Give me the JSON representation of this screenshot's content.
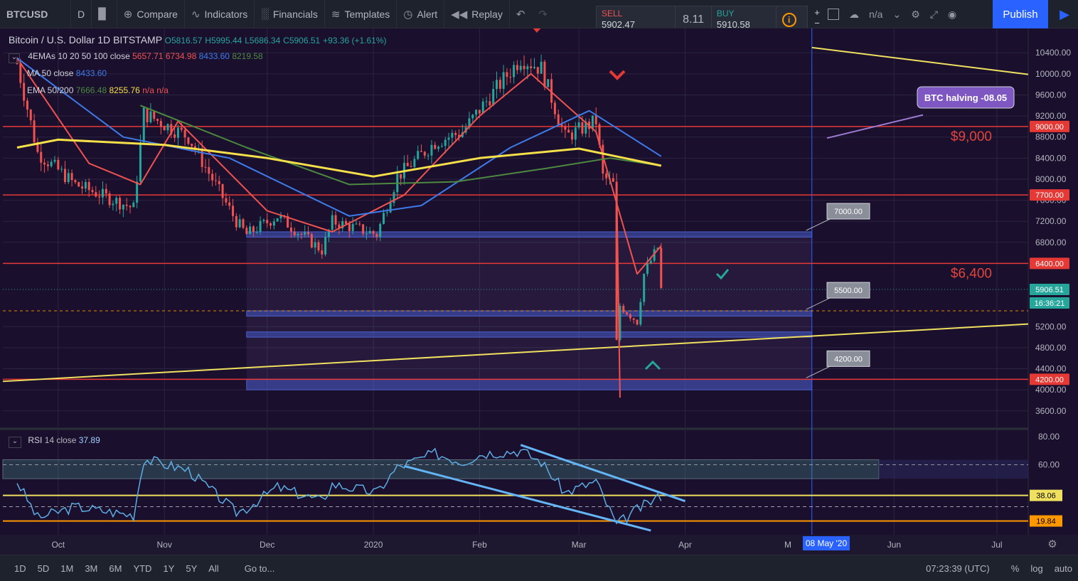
{
  "toolbar": {
    "symbol": "BTCUSD",
    "interval": "D",
    "compare": "Compare",
    "indicators": "Indicators",
    "financials": "Financials",
    "templates": "Templates",
    "alert": "Alert",
    "replay": "Replay",
    "layout_name": "n/a",
    "publish": "Publish"
  },
  "trade_panel": {
    "sell_label": "SELL",
    "sell_price": "5902.47",
    "spread": "8.11",
    "buy_label": "BUY",
    "buy_price": "5910.58",
    "plus": "+",
    "minus": "−"
  },
  "legend": {
    "main": {
      "name": "Bitcoin / U.S. Dollar",
      "interval": "1D",
      "exchange": "BITSTAMP",
      "o": "O5816.57",
      "h": "H5995.44",
      "l": "L5686.34",
      "c": "C5906.51",
      "chg": "+93.36 (+1.61%)"
    },
    "ema4": {
      "name": "4EMAs 10 20 50 100 close",
      "v1": "5657.71",
      "v2": "6734.98",
      "v3": "8433.60",
      "v4": "8219.58"
    },
    "ma50": {
      "name": "MA 50 close",
      "v1": "8433.60"
    },
    "ema50200": {
      "name": "EMA 50/200",
      "v1": "7666.48",
      "v2": "8255.76",
      "v3": "n/a",
      "v4": "n/a"
    },
    "rsi": {
      "name": "RSI",
      "params": "14 close",
      "v1": "37.89"
    }
  },
  "bottom_bar": {
    "ranges": [
      "1D",
      "5D",
      "1M",
      "3M",
      "6M",
      "YTD",
      "1Y",
      "5Y",
      "All"
    ],
    "goto": "Go to...",
    "clock": "07:23:39 (UTC)",
    "pct": "%",
    "log": "log",
    "auto": "auto"
  },
  "colors": {
    "background": "#1b0f2e",
    "up": "#26a69a",
    "down": "#ef5350",
    "ema10": "#ef5350",
    "ma50": "#3d7be8",
    "ema50": "#4c8a3f",
    "ema200": "#f5e04a",
    "trend": "#f0e060",
    "level": "#e53935",
    "zone": "#3a4fb0"
  },
  "chart_data": [
    {
      "type": "candlestick",
      "title": "Bitcoin / U.S. Dollar 1D BITSTAMP",
      "ylim": [
        3300,
        10700
      ],
      "yticks": [
        "10400.00",
        "10000.00",
        "9600.00",
        "9200.00",
        "8800.00",
        "8400.00",
        "8000.00",
        "7600.00",
        "7200.00",
        "6800.00",
        "5200.00",
        "4800.00",
        "4400.00",
        "4000.00",
        "3600.00"
      ],
      "xticks": [
        "Oct",
        "Nov",
        "Dec",
        "2020",
        "Feb",
        "Mar",
        "Apr",
        "Jun",
        "Jul"
      ],
      "x_range": [
        "2019-09-19",
        "2020-07-06"
      ],
      "price_tags": [
        {
          "label": "9000.00",
          "value": 9000,
          "color": "#e53935"
        },
        {
          "label": "7700.00",
          "value": 7700,
          "color": "#e53935"
        },
        {
          "label": "6400.00",
          "value": 6400,
          "color": "#e53935"
        },
        {
          "label": "5906.51",
          "value": 5906.51,
          "color": "#26a69a"
        },
        {
          "label": "16:36:21",
          "value": 5650,
          "color": "#26a69a"
        },
        {
          "label": "4200.00",
          "value": 4200,
          "color": "#e53935"
        }
      ],
      "horizontal_levels": [
        9000,
        7700,
        6400,
        4200
      ],
      "level_labels": [
        {
          "text": "$9,000",
          "value": 9000
        },
        {
          "text": "$6,400",
          "value": 6400
        }
      ],
      "zones": [
        [
          6900,
          7000
        ],
        [
          5400,
          5500
        ],
        [
          5000,
          5100
        ],
        [
          4000,
          4200
        ]
      ],
      "callouts": [
        {
          "text": "7000.00",
          "value": 7000
        },
        {
          "text": "5500.00",
          "value": 5500
        },
        {
          "text": "4200.00",
          "value": 4200
        }
      ],
      "annotation": "BTC halving -08.05",
      "date_tag": "08 May '20",
      "anchors": [
        {
          "date": "2019-09-19",
          "close": 10200
        },
        {
          "date": "2019-09-25",
          "close": 8500
        },
        {
          "date": "2019-10-06",
          "close": 7900
        },
        {
          "date": "2019-10-23",
          "close": 7450
        },
        {
          "date": "2019-10-26",
          "close": 9250
        },
        {
          "date": "2019-11-08",
          "close": 8800
        },
        {
          "date": "2019-11-22",
          "close": 7200
        },
        {
          "date": "2019-11-25",
          "close": 6950
        },
        {
          "date": "2019-12-04",
          "close": 7300
        },
        {
          "date": "2019-12-17",
          "close": 6650
        },
        {
          "date": "2019-12-20",
          "close": 7200
        },
        {
          "date": "2020-01-02",
          "close": 6950
        },
        {
          "date": "2020-01-08",
          "close": 8050
        },
        {
          "date": "2020-01-19",
          "close": 8700
        },
        {
          "date": "2020-01-27",
          "close": 8900
        },
        {
          "date": "2020-02-02",
          "close": 9400
        },
        {
          "date": "2020-02-13",
          "close": 10300
        },
        {
          "date": "2020-02-19",
          "close": 10100
        },
        {
          "date": "2020-02-26",
          "close": 8800
        },
        {
          "date": "2020-03-06",
          "close": 9100
        },
        {
          "date": "2020-03-08",
          "close": 8050
        },
        {
          "date": "2020-03-11",
          "close": 7900
        },
        {
          "date": "2020-03-12",
          "close": 4900
        },
        {
          "date": "2020-03-13",
          "close": 5600
        },
        {
          "date": "2020-03-18",
          "close": 5300
        },
        {
          "date": "2020-03-20",
          "close": 6200
        },
        {
          "date": "2020-03-24",
          "close": 6700
        },
        {
          "date": "2020-03-25",
          "close": 5906.51
        }
      ],
      "series": [
        {
          "name": "EMA 10",
          "points": [
            [
              "2019-09-19",
              10300
            ],
            [
              "2019-10-10",
              8300
            ],
            [
              "2019-10-25",
              7900
            ],
            [
              "2019-11-05",
              9100
            ],
            [
              "2019-12-01",
              7400
            ],
            [
              "2019-12-20",
              7000
            ],
            [
              "2020-01-10",
              7700
            ],
            [
              "2020-02-01",
              9200
            ],
            [
              "2020-02-16",
              10000
            ],
            [
              "2020-03-06",
              8900
            ],
            [
              "2020-03-18",
              6200
            ],
            [
              "2020-03-25",
              6735
            ]
          ]
        },
        {
          "name": "MA 50",
          "points": [
            [
              "2019-09-19",
              10300
            ],
            [
              "2019-10-20",
              8800
            ],
            [
              "2019-11-20",
              8400
            ],
            [
              "2019-12-25",
              7300
            ],
            [
              "2020-01-15",
              7500
            ],
            [
              "2020-02-10",
              8600
            ],
            [
              "2020-03-04",
              9300
            ],
            [
              "2020-03-25",
              8434
            ]
          ]
        },
        {
          "name": "EMA 50",
          "points": [
            [
              "2019-10-25",
              9400
            ],
            [
              "2019-11-25",
              8600
            ],
            [
              "2019-12-25",
              7900
            ],
            [
              "2020-01-25",
              7950
            ],
            [
              "2020-02-20",
              8200
            ],
            [
              "2020-03-10",
              8400
            ],
            [
              "2020-03-25",
              8256
            ]
          ]
        },
        {
          "name": "EMA 200",
          "points": [
            [
              "2019-09-19",
              8600
            ],
            [
              "2019-10-01",
              8750
            ],
            [
              "2019-11-01",
              8650
            ],
            [
              "2019-12-01",
              8400
            ],
            [
              "2020-01-01",
              8050
            ],
            [
              "2020-02-01",
              8400
            ],
            [
              "2020-03-01",
              8580
            ],
            [
              "2020-03-25",
              8256
            ]
          ]
        }
      ]
    },
    {
      "type": "line",
      "title": "RSI 14 close",
      "ylim": [
        10,
        84
      ],
      "yticks": [
        "80.00",
        "60.00"
      ],
      "price_tags": [
        {
          "label": "38.06",
          "value": 38.06
        },
        {
          "label": "19.84",
          "value": 19.84
        }
      ],
      "current": 37.89,
      "points": [
        [
          "2019-09-19",
          48
        ],
        [
          "2019-09-25",
          22
        ],
        [
          "2019-10-06",
          30
        ],
        [
          "2019-10-23",
          24
        ],
        [
          "2019-10-26",
          64
        ],
        [
          "2019-11-08",
          56
        ],
        [
          "2019-11-22",
          26
        ],
        [
          "2019-11-25",
          29
        ],
        [
          "2019-12-04",
          44
        ],
        [
          "2019-12-17",
          34
        ],
        [
          "2019-12-20",
          46
        ],
        [
          "2020-01-02",
          40
        ],
        [
          "2020-01-08",
          58
        ],
        [
          "2020-01-19",
          68
        ],
        [
          "2020-01-27",
          62
        ],
        [
          "2020-02-02",
          68
        ],
        [
          "2020-02-13",
          70
        ],
        [
          "2020-02-19",
          62
        ],
        [
          "2020-02-26",
          40
        ],
        [
          "2020-03-06",
          48
        ],
        [
          "2020-03-12",
          17
        ],
        [
          "2020-03-18",
          28
        ],
        [
          "2020-03-25",
          37.89
        ]
      ]
    }
  ]
}
